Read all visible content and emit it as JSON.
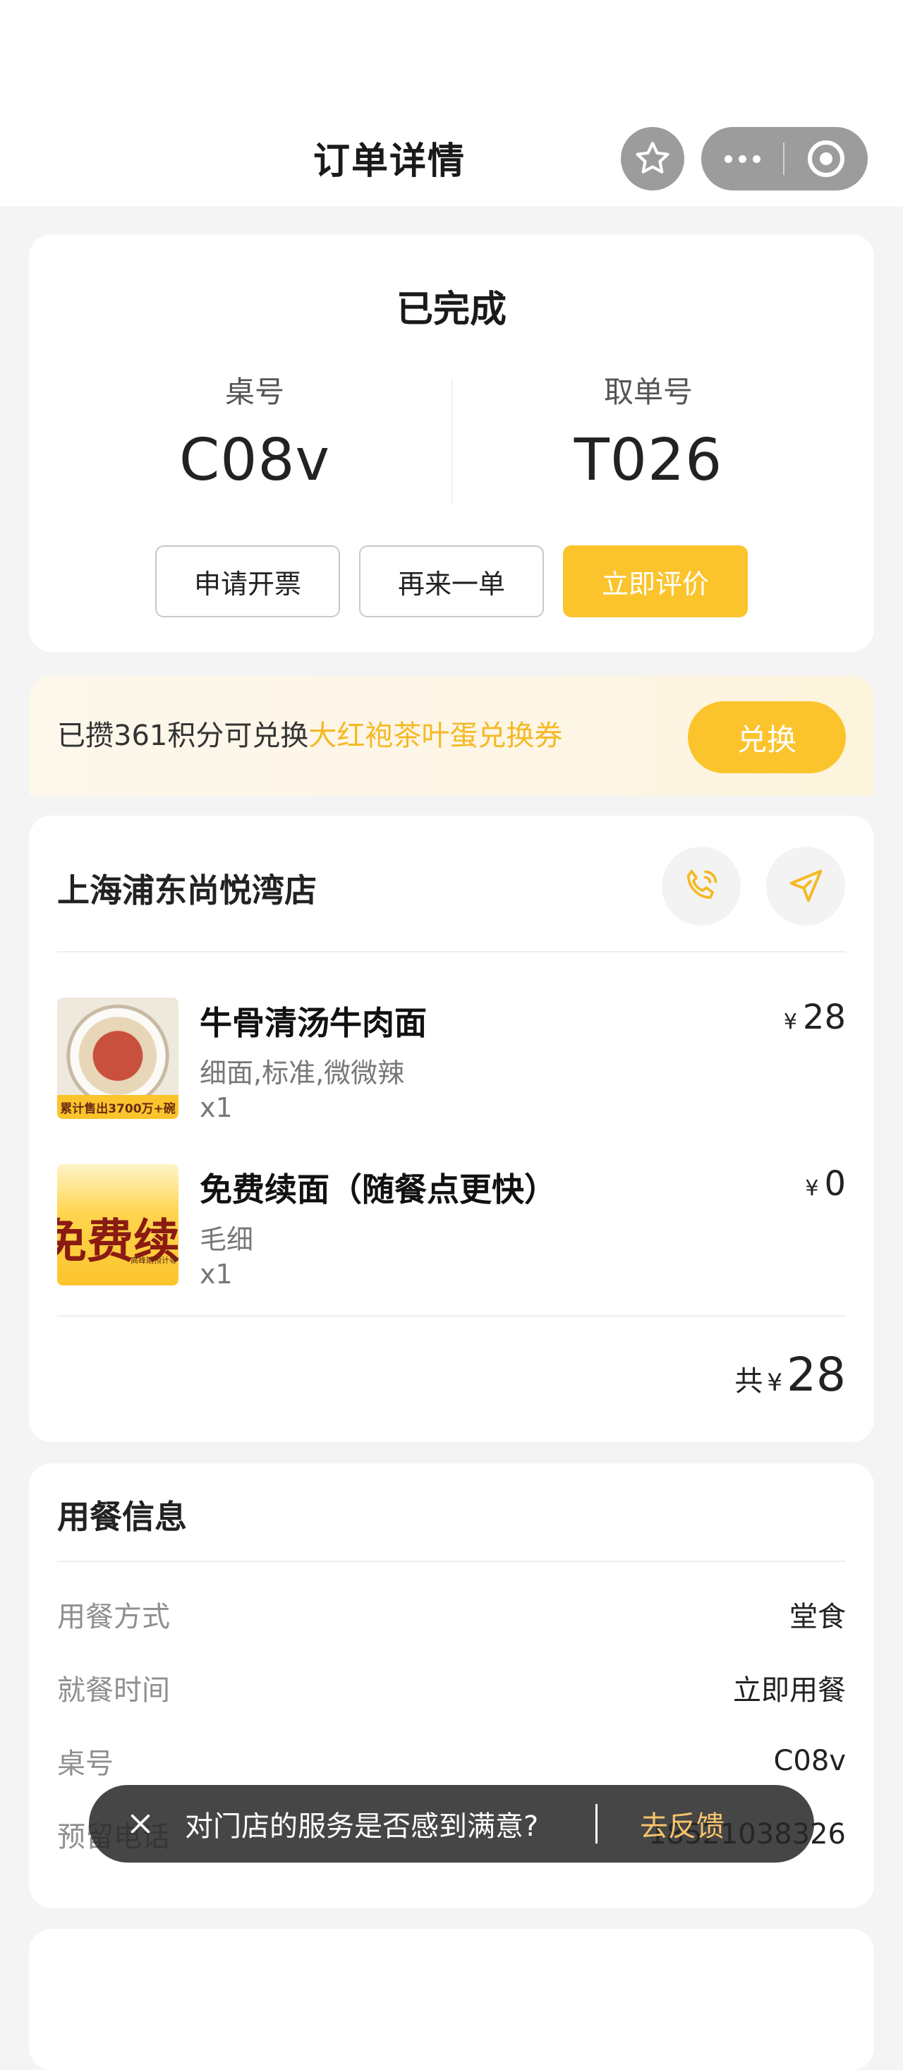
{
  "header": {
    "title": "订单详情",
    "favorite_icon": "star-icon",
    "more_icon": "more-dots-icon",
    "close_icon": "target-close-icon"
  },
  "status": {
    "title": "已完成",
    "table_label": "桌号",
    "table_value": "C08v",
    "pickup_label": "取单号",
    "pickup_value": "T026",
    "buttons": {
      "invoice": "申请开票",
      "reorder": "再来一单",
      "review": "立即评价"
    }
  },
  "points": {
    "prefix": "已攒361积分可兑换",
    "highlight": "大红袍茶叶蛋兑换券",
    "redeem_label": "兑换"
  },
  "order": {
    "store_name": "上海浦东尚悦湾店",
    "items": [
      {
        "name": "牛骨清汤牛肉面",
        "spec": "细面,标准,微微辣",
        "qty": "x1",
        "currency": "¥",
        "price": "28",
        "thumb_band": "累计售出3700万+碗"
      },
      {
        "name": "免费续面（随餐点更快）",
        "spec": "毛细",
        "qty": "x1",
        "currency": "¥",
        "price": "0",
        "thumb_big": "免费续面",
        "thumb_small": "高峰期预计等待"
      }
    ],
    "total_label": "共",
    "total_currency": "¥",
    "total_amount": "28"
  },
  "dining": {
    "title": "用餐信息",
    "rows": [
      {
        "key": "用餐方式",
        "value": "堂食"
      },
      {
        "key": "就餐时间",
        "value": "立即用餐"
      },
      {
        "key": "桌号",
        "value": "C08v"
      },
      {
        "key": "预留电话",
        "value": "18521038326"
      }
    ]
  },
  "toast": {
    "message": "对门店的服务是否感到满意?",
    "action": "去反馈"
  },
  "colors": {
    "accent": "#fbc42c",
    "highlight_text": "#f5b925",
    "toast_link": "#f7c46c"
  }
}
